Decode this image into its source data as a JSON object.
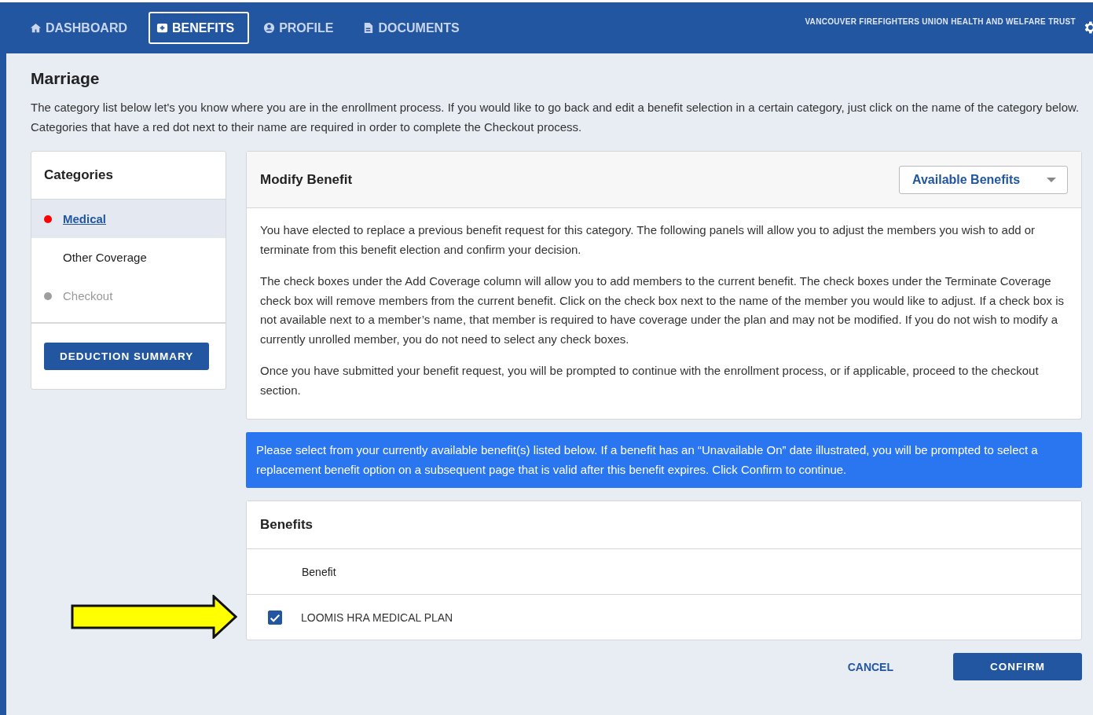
{
  "nav": {
    "tabs": [
      {
        "label": "DASHBOARD",
        "selected": false
      },
      {
        "label": "BENEFITS",
        "selected": true
      },
      {
        "label": "PROFILE",
        "selected": false
      },
      {
        "label": "DOCUMENTS",
        "selected": false
      }
    ],
    "org_name": "VANCOUVER FIREFIGHTERS UNION HEALTH AND WELFARE TRUST"
  },
  "page": {
    "title": "Marriage",
    "intro": "The category list below let's you know where you are in the enrollment process. If you would like to go back and edit a benefit selection in a certain category, just click on the name of the category below. Categories that have a red dot next to their name are required in order to complete the Checkout process."
  },
  "sidebar": {
    "title": "Categories",
    "items": [
      {
        "label": "Medical",
        "selected": true,
        "disabled": false,
        "color": "#ff0000"
      },
      {
        "label": "Other Coverage",
        "selected": false,
        "disabled": false
      },
      {
        "label": "Checkout",
        "selected": false,
        "disabled": true,
        "color": "#9e9e9e"
      }
    ],
    "button": "DEDUCTION SUMMARY"
  },
  "modify_panel": {
    "title": "Modify Benefit",
    "dropdown": "Available Benefits",
    "paragraphs": [
      "You have elected to replace a previous benefit request for this category. The following panels will allow you to adjust the members you wish to add or terminate from this benefit election and confirm your decision.",
      "The check boxes under the Add Coverage column will allow you to add members to the current benefit. The check boxes under the Terminate Coverage check box will remove members from the current benefit. Click on the check box next to the name of the member you would like to adjust. If a check box is not available next to a member’s name, that member is required to have coverage under the plan and may not be modified. If you do not wish to modify a currently unrolled member, you do not need to select any check boxes.",
      "Once you have submitted your benefit request, you will be prompted to continue with the enrollment process, or if applicable, proceed to the checkout section."
    ]
  },
  "notice": "Please select from your currently available benefit(s) listed below. If a benefit has an “Unavailable On” date illustrated, you will be prompted to select a replacement benefit option on a subsequent page that is valid after this benefit expires. Click Confirm to continue.",
  "benefits": {
    "title": "Benefits",
    "column": "Benefit",
    "rows": [
      {
        "name": "LOOMIS HRA MEDICAL PLAN",
        "checked": true
      }
    ]
  },
  "actions": {
    "cancel": "CANCEL",
    "confirm": "CONFIRM"
  }
}
